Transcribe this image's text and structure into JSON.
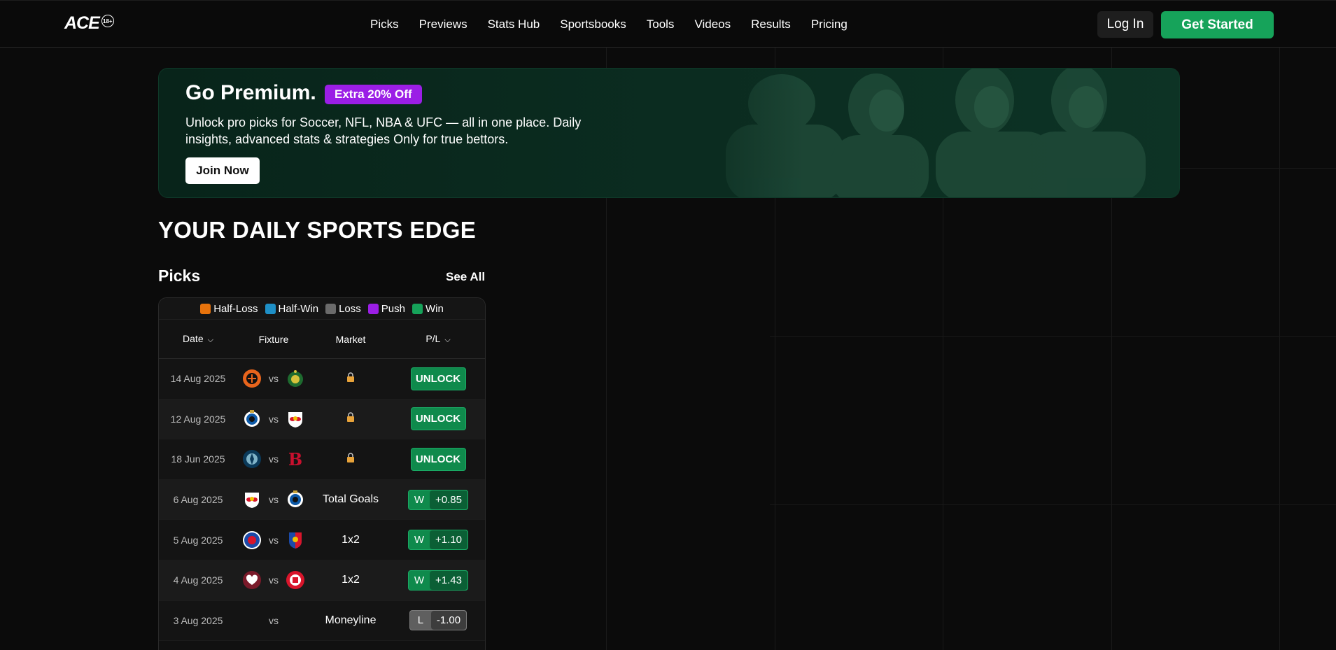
{
  "header": {
    "logo": "ACE",
    "logo_badge": "18+",
    "nav": [
      "Picks",
      "Previews",
      "Stats Hub",
      "Sportsbooks",
      "Tools",
      "Videos",
      "Results",
      "Pricing"
    ],
    "login": "Log In",
    "get_started": "Get Started"
  },
  "banner": {
    "title": "Go Premium.",
    "badge": "Extra 20% Off",
    "description": "Unlock pro picks for Soccer, NFL, NBA & UFC — all in one place. Daily insights, advanced stats & strategies Only for true bettors.",
    "join": "Join Now"
  },
  "section_title": "YOUR DAILY SPORTS EDGE",
  "picks": {
    "title": "Picks",
    "see_all": "See All",
    "legend": [
      {
        "label": "Half-Loss",
        "color": "#e8730c"
      },
      {
        "label": "Half-Win",
        "color": "#1e8fc6"
      },
      {
        "label": "Loss",
        "color": "#6b6b6b"
      },
      {
        "label": "Push",
        "color": "#9b1ee6"
      },
      {
        "label": "Win",
        "color": "#16a35a"
      }
    ],
    "columns": {
      "date": "Date",
      "fixture": "Fixture",
      "market": "Market",
      "pl": "P/L"
    },
    "vs": "vs",
    "unlock_label": "UNLOCK",
    "rows": [
      {
        "date": "14 Aug 2025",
        "home": "orange-crest",
        "away": "green-crest",
        "market": "",
        "locked": true
      },
      {
        "date": "12 Aug 2025",
        "home": "blue-crest",
        "away": "red-bull-crest",
        "market": "",
        "locked": true
      },
      {
        "date": "18 Jun 2025",
        "home": "navy-crest",
        "away": "red-sox-crest",
        "market": "",
        "locked": true
      },
      {
        "date": "6 Aug 2025",
        "home": "red-bull-crest",
        "away": "blue-crest",
        "market": "Total Goals",
        "locked": false,
        "result": "W",
        "pl": "+0.85"
      },
      {
        "date": "5 Aug 2025",
        "home": "rangers-crest",
        "away": "plzen-crest",
        "market": "1x2",
        "locked": false,
        "result": "W",
        "pl": "+1.10"
      },
      {
        "date": "4 Aug 2025",
        "home": "hearts-crest",
        "away": "red-circle-crest",
        "market": "1x2",
        "locked": false,
        "result": "W",
        "pl": "+1.43"
      },
      {
        "date": "3 Aug 2025",
        "home": "",
        "away": "",
        "market": "Moneyline",
        "locked": false,
        "result": "L",
        "pl": "-1.00"
      }
    ]
  }
}
